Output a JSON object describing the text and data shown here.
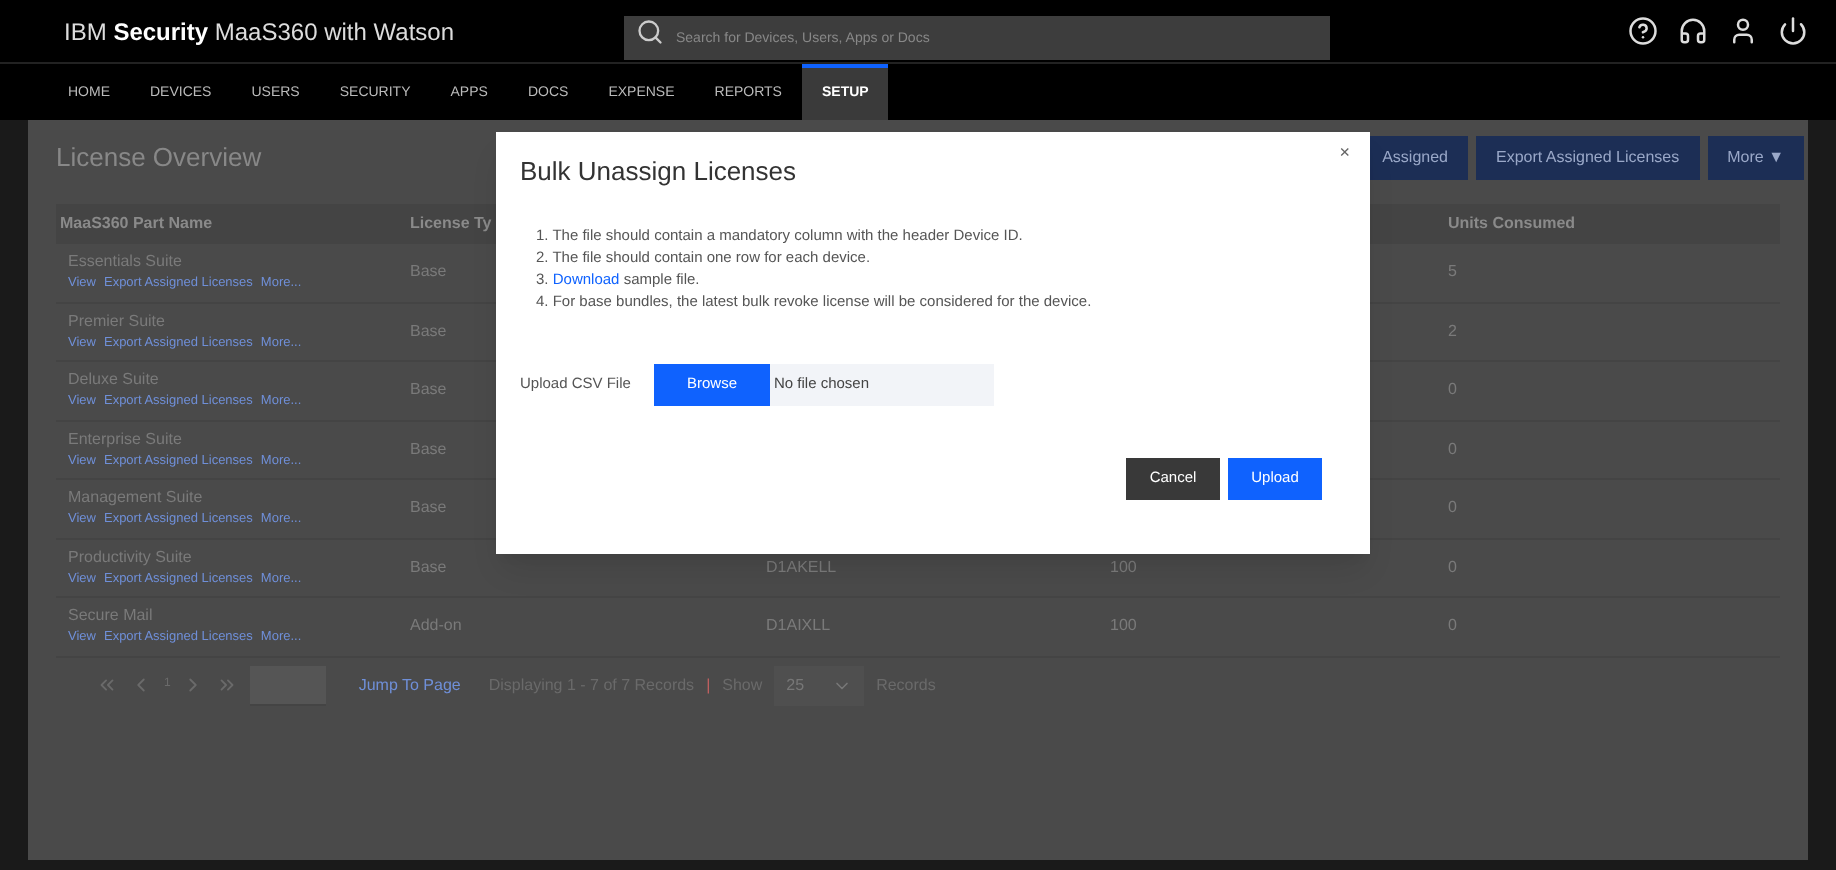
{
  "header": {
    "brand_prefix": "IBM",
    "brand_bold": "Security",
    "brand_suffix": "MaaS360 with Watson",
    "search": {
      "placeholder": "Search for Devices, Users, Apps or Docs"
    }
  },
  "nav": [
    {
      "label": "HOME",
      "selected": false
    },
    {
      "label": "DEVICES",
      "selected": false
    },
    {
      "label": "USERS",
      "selected": false
    },
    {
      "label": "SECURITY",
      "selected": false
    },
    {
      "label": "APPS",
      "selected": false
    },
    {
      "label": "DOCS",
      "selected": false
    },
    {
      "label": "EXPENSE",
      "selected": false
    },
    {
      "label": "REPORTS",
      "selected": false
    },
    {
      "label": "SETUP",
      "selected": true
    }
  ],
  "page": {
    "title": "License Overview",
    "actions": [
      "Assigned",
      "Export Assigned Licenses",
      "More ▼"
    ]
  },
  "table": {
    "columns": {
      "column_1": "MaaS360 Part Name",
      "column_2": "License Ty",
      "column_5": "Units Consumed"
    },
    "rows": [
      {
        "name": "Essentials Suite",
        "links": [
          "View",
          "Export Assigned Licenses",
          "More..."
        ],
        "type": "Base",
        "units": "5"
      },
      {
        "name": "Premier Suite",
        "links": [
          "View",
          "Export Assigned Licenses",
          "More..."
        ],
        "type": "Base",
        "units": "2"
      },
      {
        "name": "Deluxe Suite",
        "links": [
          "View",
          "Export Assigned Licenses",
          "More..."
        ],
        "type": "Base",
        "units": "0"
      },
      {
        "name": "Enterprise Suite",
        "links": [
          "View",
          "Export Assigned Licenses",
          "More..."
        ],
        "type": "Base",
        "units": "0"
      },
      {
        "name": "Management Suite",
        "links": [
          "View",
          "Export Assigned Licenses",
          "More..."
        ],
        "type": "Base",
        "units": "0"
      },
      {
        "name": "Productivity Suite",
        "links": [
          "View",
          "Export Assigned Licenses",
          "More..."
        ],
        "type": "Base",
        "column_3": "D1AKELL",
        "column_4": "100",
        "units": "0"
      },
      {
        "name": "Secure Mail",
        "links": [
          "View",
          "Export Assigned Licenses",
          "More..."
        ],
        "type": "Add-on",
        "column_3": "D1AIXLL",
        "column_4": "100",
        "units": "0"
      }
    ]
  },
  "pagination": {
    "page": "1",
    "jump": "Jump To Page",
    "displaying": "Displaying 1 - 7 of 7 Records",
    "separator": "|",
    "show": "Show",
    "per_page": "25",
    "records": "Records"
  },
  "dialog": {
    "title": "Bulk Unassign Licenses",
    "close": "×",
    "instructions": [
      "1. The file should contain a mandatory column with the header Device ID.",
      "2. The file should contain one row for each device.",
      {
        "number": "3.",
        "link": "Download",
        "rest": "sample file."
      },
      "4. For base bundles, the latest bulk revoke license will be considered for the device."
    ],
    "upload_label": "Upload CSV File",
    "browse": "Browse",
    "file_status": "No file chosen",
    "buttons": [
      {
        "label": "Cancel",
        "kind": "secondary"
      },
      {
        "label": "Upload",
        "kind": "primary"
      }
    ]
  }
}
